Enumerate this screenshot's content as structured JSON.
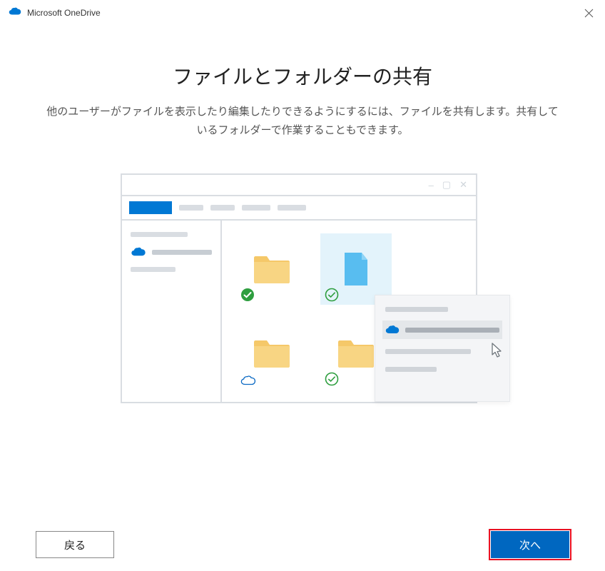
{
  "titlebar": {
    "app_name": "Microsoft OneDrive"
  },
  "heading": "ファイルとフォルダーの共有",
  "subtext": "他のユーザーがファイルを表示したり編集したりできるようにするには、ファイルを共有します。共有しているフォルダーで作業することもできます。",
  "buttons": {
    "back": "戻る",
    "next": "次へ"
  }
}
